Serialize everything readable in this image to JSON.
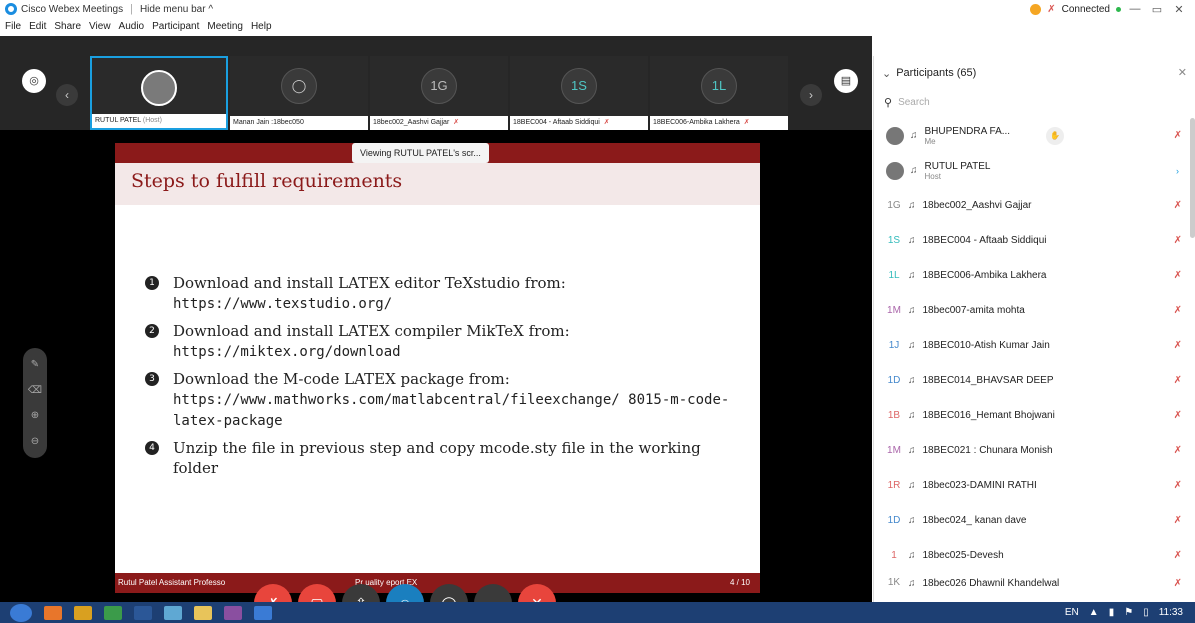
{
  "window": {
    "app_title": "Cisco Webex Meetings",
    "hide_menu_label": "Hide menu bar ^",
    "status": "Connected"
  },
  "menu": [
    "File",
    "Edit",
    "Share",
    "View",
    "Audio",
    "Participant",
    "Meeting",
    "Help"
  ],
  "thumbnails": [
    {
      "name": "RUTUL PATEL",
      "role": "(Host)",
      "avatar": "photo",
      "muted": false
    },
    {
      "name": "Manan Jain :18bec050",
      "avatar": "user-icon",
      "muted": false
    },
    {
      "name": "18bec002_Aashvi Gajjar",
      "avatar": "1G",
      "muted": true
    },
    {
      "name": "18BEC004 - Aftaab Siddiqui",
      "avatar": "1S",
      "muted": true
    },
    {
      "name": "18BEC006-Ambika Lakhera",
      "avatar": "1L",
      "muted": true
    }
  ],
  "slide": {
    "viewing_label": "Viewing RUTUL PATEL's scr...",
    "heading": "Steps to fulfill requirements",
    "items": [
      {
        "num": "1",
        "text": "Download and install LATEX editor TeXstudio from:",
        "url": "https://www.texstudio.org/"
      },
      {
        "num": "2",
        "text": "Download and install LATEX compiler MikTeX from:",
        "url": "https://miktex.org/download"
      },
      {
        "num": "3",
        "text": "Download the M-code LATEX package from:",
        "url": "https://www.mathworks.com/matlabcentral/fileexchange/ 8015-m-code-latex-package"
      },
      {
        "num": "4",
        "text": "Unzip the file in previous step and copy mcode.sty file in the working folder",
        "url": ""
      }
    ],
    "footer_left": "Rutul Patel Assistant Professo",
    "footer_mid": "Pr         uality      eport        EX",
    "footer_page": "4 / 10"
  },
  "participants": {
    "header": "Participants (65)",
    "search_placeholder": "Search",
    "list": [
      {
        "name": "BHUPENDRA FA...",
        "sub": "Me",
        "avatar": "photo",
        "initials": "",
        "color": "",
        "muted": true,
        "hand": true
      },
      {
        "name": "RUTUL PATEL",
        "sub": "Host",
        "avatar": "photo",
        "initials": "",
        "color": "",
        "muted": false,
        "host": true
      },
      {
        "name": "18bec002_Aashvi Gajjar",
        "sub": "",
        "initials": "1G",
        "color": "grey",
        "muted": true
      },
      {
        "name": "18BEC004 - Aftaab Siddiqui",
        "sub": "",
        "initials": "1S",
        "color": "teal",
        "muted": true
      },
      {
        "name": "18BEC006-Ambika Lakhera",
        "sub": "",
        "initials": "1L",
        "color": "teal",
        "muted": true
      },
      {
        "name": "18bec007-amita mohta",
        "sub": "",
        "initials": "1M",
        "color": "purple",
        "muted": true
      },
      {
        "name": "18BEC010-Atish Kumar Jain",
        "sub": "",
        "initials": "1J",
        "color": "blue",
        "muted": true
      },
      {
        "name": "18BEC014_BHAVSAR DEEP",
        "sub": "",
        "initials": "1D",
        "color": "blue",
        "muted": true
      },
      {
        "name": "18BEC016_Hemant Bhojwani",
        "sub": "",
        "initials": "1B",
        "color": "red",
        "muted": true
      },
      {
        "name": "18BEC021 : Chunara Monish",
        "sub": "",
        "initials": "1M",
        "color": "purple",
        "muted": true
      },
      {
        "name": "18bec023-DAMINI RATHI",
        "sub": "",
        "initials": "1R",
        "color": "red",
        "muted": true
      },
      {
        "name": "18bec024_ kanan dave",
        "sub": "",
        "initials": "1D",
        "color": "blue",
        "muted": true
      },
      {
        "name": "18bec025-Devesh",
        "sub": "",
        "initials": "1",
        "color": "red",
        "muted": true
      },
      {
        "name": "18bec026 Dhawnil Khandelwal",
        "sub": "",
        "initials": "1K",
        "color": "grey",
        "muted": true
      }
    ]
  },
  "taskbar": {
    "lang": "EN",
    "time": "11:33"
  }
}
